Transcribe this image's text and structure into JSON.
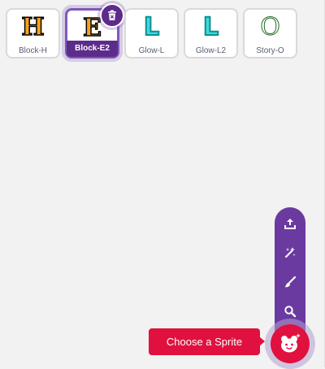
{
  "sprites": [
    {
      "name": "Block-H",
      "letter": "H",
      "style": "block",
      "fill": "#f7a21b",
      "selected": false
    },
    {
      "name": "Block-E2",
      "letter": "E",
      "style": "block",
      "fill": "#f7a21b",
      "selected": true
    },
    {
      "name": "Glow-L",
      "letter": "L",
      "style": "glow",
      "fill": "#3fd9dd",
      "selected": false
    },
    {
      "name": "Glow-L2",
      "letter": "L",
      "style": "glow",
      "fill": "#3fd9dd",
      "selected": false
    },
    {
      "name": "Story-O",
      "letter": "O",
      "style": "story",
      "fill": "#ffffff",
      "selected": false
    }
  ],
  "sprite_menu": {
    "tooltip": "Choose a Sprite",
    "items": [
      {
        "icon": "upload-icon"
      },
      {
        "icon": "surprise-icon"
      },
      {
        "icon": "paint-icon"
      },
      {
        "icon": "search-icon"
      }
    ],
    "main_icon": "cat-icon"
  },
  "colors": {
    "accent": "#7f59b9",
    "selected_bar": "#5d2b8a",
    "menu": "#6a3aa0",
    "choose": "#e0113e"
  }
}
